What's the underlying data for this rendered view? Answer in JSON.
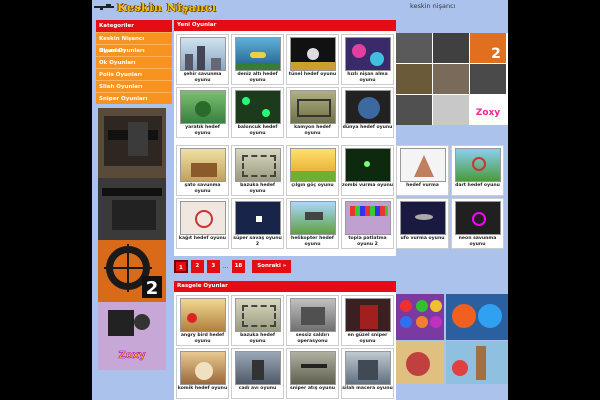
{
  "header": {
    "logo_text": "Keskin Nişancı",
    "site_name": "keskin nişancı"
  },
  "categories": {
    "title": "Kategoriler",
    "items": [
      "Keskin Nişancı Oyunları",
      "Nişan Oyunları",
      "Ok Oyunları",
      "Polis Oyunları",
      "Silah Oyunları",
      "Sniper Oyunları"
    ]
  },
  "new_games": {
    "title": "Yeni Oyunlar",
    "rows": [
      [
        "şehir savunma oyunu",
        "deniz altı hedef oyunu",
        "tünel hedef oyunu",
        "hızlı nişan alma oyunu"
      ],
      [
        "yaratık hedef oyunu",
        "baloncuk hedef oyunu",
        "kamyon hedef oyunu",
        "dünya hedef oyunu"
      ],
      [
        "şato savunma oyunu",
        "bazuka hedef oyunu",
        "çılgın göç oyunu",
        "zombi vurma oyunu",
        "hedef vurma",
        "dart hedef oyunu"
      ],
      [
        "kağıt hedef oyunu",
        "süper savaş oyunu 2",
        "helikopter hedef oyunu",
        "topla patlatma oyunu 2",
        "ufo vurma oyunu",
        "neon savunma oyunu"
      ]
    ]
  },
  "pagination": {
    "pages": [
      "1",
      "2",
      "3"
    ],
    "ellipsis": "...",
    "last": "18",
    "next": "Sonraki »"
  },
  "random_games": {
    "title": "Rasgele Oyunlar",
    "rows": [
      [
        "angry bird hedef oyunu",
        "bazuka hedef oyunu",
        "sessiz saldırı operasyonu",
        "en güzel sniper oyunu"
      ],
      [
        "komik hedef oyunu",
        "cadı avı oyunu",
        "sniper atış oyunu",
        "silah macera oyunu"
      ]
    ]
  },
  "ads": {
    "side_number": "2",
    "side_brand": "Zoxy",
    "right_number": "2",
    "right_brand": "Zoxy"
  },
  "colors": {
    "accent_red": "#e40d14",
    "category_orange": "#f7931e",
    "page_bg": "#abc3ec"
  }
}
